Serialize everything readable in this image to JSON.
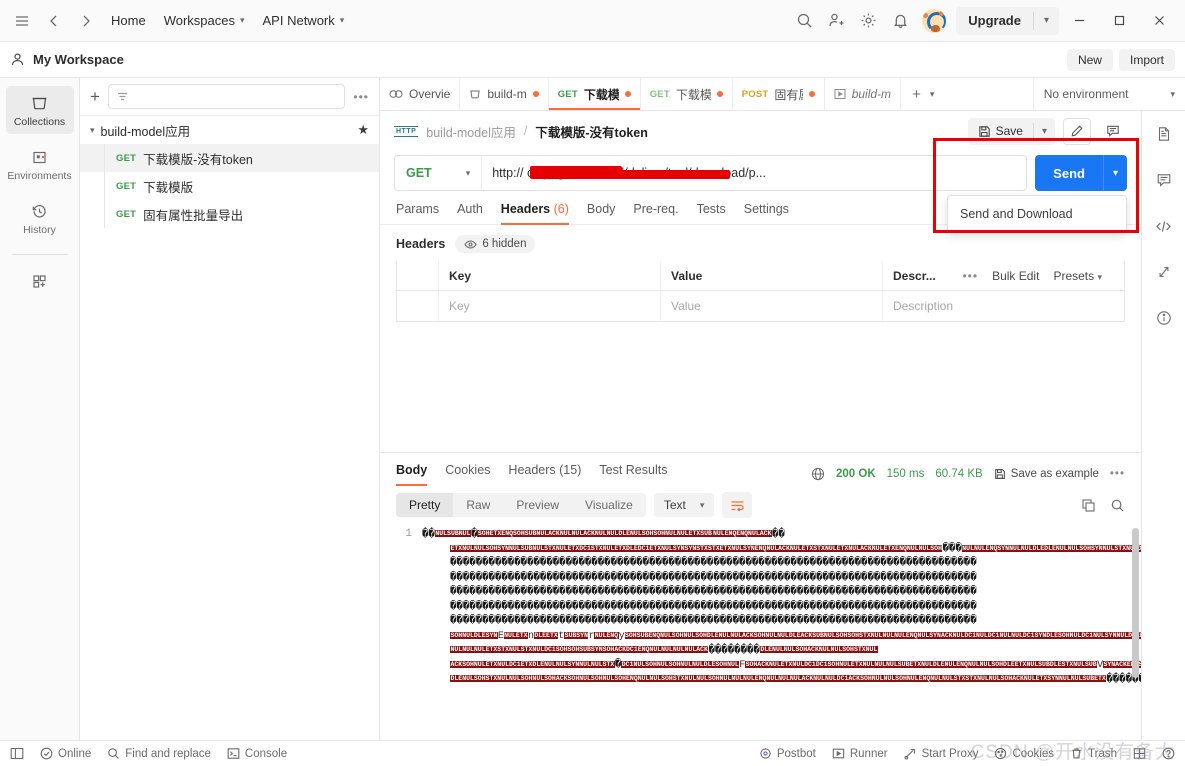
{
  "topbar": {
    "menu_icon": "hamburger-icon",
    "back_icon": "arrow-left-icon",
    "forward_icon": "arrow-right-icon",
    "home": "Home",
    "workspaces": "Workspaces",
    "api_network": "API Network",
    "search_icon": "search-icon",
    "invite_icon": "invite-user-icon",
    "settings_icon": "gear-icon",
    "notifications_icon": "bell-icon",
    "avatar": "user-avatar",
    "upgrade": "Upgrade",
    "minimize": "—",
    "maximize": "□",
    "close": "✕"
  },
  "workspace": {
    "name": "My Workspace",
    "new_label": "New",
    "import_label": "Import"
  },
  "rail": {
    "items": [
      {
        "label": "Collections",
        "icon": "collections-icon",
        "active": true
      },
      {
        "label": "Environments",
        "icon": "environments-icon",
        "active": false
      },
      {
        "label": "History",
        "icon": "history-icon",
        "active": false
      }
    ],
    "add_label": "add-module-icon"
  },
  "sidebar": {
    "filter_placeholder": "",
    "filter_icon": "filter-icon",
    "add_icon": "plus-icon",
    "more_icon": "more-horizontal-icon",
    "collection": {
      "name": "build-model应用",
      "starred": true,
      "chevron": "⌄"
    },
    "requests": [
      {
        "method": "GET",
        "name": "下载模版-没有token",
        "active": true
      },
      {
        "method": "GET",
        "name": "下载模版",
        "active": false
      },
      {
        "method": "GET",
        "name": "固有属性批量导出",
        "active": false
      }
    ]
  },
  "tabbar": {
    "tabs": [
      {
        "label": "Overvie",
        "icon": "overview-icon",
        "dirty": false,
        "active": false,
        "italic": false
      },
      {
        "label": "build-m",
        "icon": "collection-icon",
        "dirty": true,
        "active": false,
        "italic": false
      },
      {
        "method": "GET",
        "label": "下载模",
        "dirty": true,
        "active": true,
        "italic": false
      },
      {
        "method": "GET",
        "label": "下载模",
        "dirty": true,
        "active": false,
        "italic": false
      },
      {
        "method": "POST",
        "label": "固有属",
        "dirty": true,
        "active": false,
        "italic": false
      },
      {
        "label": "build-m",
        "icon": "runner-icon",
        "dirty": false,
        "active": false,
        "italic": true
      }
    ],
    "new_tab_icon": "plus-icon",
    "tab_list_icon": "chevron-down-icon",
    "environment": "No environment",
    "env_chevron": "⌄",
    "env_quick_look_icon": "eye-document-icon"
  },
  "request": {
    "breadcrumb_protocol": "HTTP",
    "breadcrumb_collection": "build-model应用",
    "breadcrumb_separator": "/",
    "breadcrumb_name": "下载模版-没有token",
    "save_label": "Save",
    "save_icon": "floppy-disk-icon",
    "save_chevron": "⌄",
    "edit_icon": "pencil-icon",
    "comment_icon": "comment-icon",
    "method": "GET",
    "method_chevron": "⌄",
    "url": "http://            cn/page/cim/build/deliver/tool/download/p...",
    "url_prefix": "http://",
    "url_suffix": "cn/page/cim/build/deliver/tool/download/p...",
    "send_label": "Send",
    "send_chevron": "⌄",
    "send_menu": [
      "Send and Download"
    ],
    "tabs": [
      {
        "label": "Params",
        "count": "",
        "active": false
      },
      {
        "label": "Auth",
        "count": "",
        "active": false
      },
      {
        "label": "Headers",
        "count": "(6)",
        "active": true
      },
      {
        "label": "Body",
        "count": "",
        "active": false
      },
      {
        "label": "Pre-req.",
        "count": "",
        "active": false
      },
      {
        "label": "Tests",
        "count": "",
        "active": false
      },
      {
        "label": "Settings",
        "count": "",
        "active": false
      }
    ],
    "headers_title": "Headers",
    "hidden_pill": "6 hidden",
    "hidden_pill_icon": "eye-icon",
    "table": {
      "columns": [
        "Key",
        "Value",
        "Descr..."
      ],
      "tools": [
        "Bulk Edit",
        "Presets"
      ],
      "tools_more_icon": "more-horizontal-icon",
      "presets_chevron": "⌄",
      "placeholder_row": [
        "Key",
        "Value",
        "Description"
      ]
    }
  },
  "response": {
    "tabs": [
      {
        "label": "Body",
        "active": true
      },
      {
        "label": "Cookies",
        "active": false
      },
      {
        "label": "Headers (15)",
        "active": false
      },
      {
        "label": "Test Results",
        "active": false
      }
    ],
    "network_icon": "globe-icon",
    "status": "200 OK",
    "time": "150 ms",
    "size": "60.74 KB",
    "save_example": "Save as example",
    "save_example_icon": "floppy-disk-icon",
    "more_icon": "more-horizontal-icon",
    "view_modes": [
      {
        "label": "Pretty",
        "active": true
      },
      {
        "label": "Raw",
        "active": false
      },
      {
        "label": "Preview",
        "active": false
      },
      {
        "label": "Visualize",
        "active": false
      }
    ],
    "format": "Text",
    "format_chevron": "⌄",
    "wrap_icon": "wrap-lines-icon",
    "copy_icon": "copy-icon",
    "search_icon": "search-icon",
    "line_number": "1",
    "body_note": "binary-content"
  },
  "right_rail": {
    "items": [
      {
        "icon": "documentation-icon"
      },
      {
        "icon": "comment-icon"
      },
      {
        "icon": "code-icon"
      },
      {
        "icon": "sync-icon"
      },
      {
        "icon": "info-icon"
      }
    ]
  },
  "statusbar": {
    "sidebar_toggle_icon": "panel-toggle-icon",
    "left": [
      {
        "label": "Online",
        "icon": "check-circle-icon"
      },
      {
        "label": "Find and replace",
        "icon": "search-icon"
      },
      {
        "label": "Console",
        "icon": "terminal-icon"
      }
    ],
    "right": [
      {
        "label": "Postbot",
        "icon": "postbot-icon"
      },
      {
        "label": "Runner",
        "icon": "play-icon"
      },
      {
        "label": "Start Proxy",
        "icon": "proxy-icon"
      },
      {
        "label": "Cookies",
        "icon": "cookie-icon"
      },
      {
        "label": "Trash",
        "icon": "trash-icon"
      },
      {
        "label": "",
        "icon": "layout-icon"
      },
      {
        "label": "",
        "icon": "help-icon"
      }
    ],
    "watermark": "CSDN @开水没有备大"
  }
}
